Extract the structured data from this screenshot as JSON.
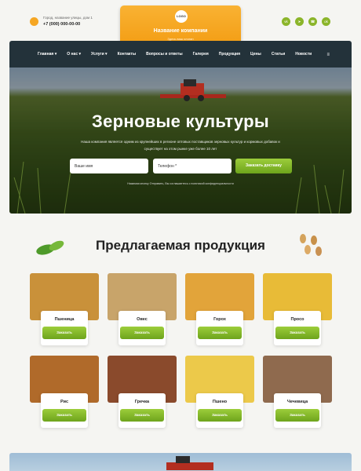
{
  "header": {
    "address": "Город, название улицы, дом 1",
    "phone": "+7 (000) 000-00-00",
    "logo_badge": "LOGO",
    "company_name": "Название компании",
    "tagline": "Здесь ваш слоган",
    "socials": [
      "vk",
      "tg",
      "wa",
      "ok"
    ]
  },
  "nav": {
    "items": [
      "Главная",
      "О нас",
      "Услуги",
      "Контакты",
      "Вопросы и ответы",
      "Галерея",
      "Продукция",
      "Цены",
      "Статьи",
      "Новости"
    ],
    "menu_icon": "≡"
  },
  "hero": {
    "title": "Зерновые культуры",
    "subtitle": "Наша компания является одним из крупнейших в регионе оптовых поставщиков зерновых культур и кормовых добавок и существует на этом рынке уже более 10 лет",
    "name_placeholder": "Ваше имя",
    "phone_placeholder": "Телефон *",
    "button": "Заказать доставку",
    "consent": "Нажимая кнопку Отправить, Вы соглашаетесь с политикой конфиденциальности"
  },
  "products": {
    "title": "Предлагаемая продукция",
    "order_label": "Заказать",
    "items": [
      {
        "name": "Пшеница",
        "color": "#c9913a"
      },
      {
        "name": "Овес",
        "color": "#c8a46a"
      },
      {
        "name": "Горох",
        "color": "#e2a43a"
      },
      {
        "name": "Просо",
        "color": "#e8bb37"
      },
      {
        "name": "Рис",
        "color": "#b06a2a"
      },
      {
        "name": "Гречка",
        "color": "#8a4a2c"
      },
      {
        "name": "Пшено",
        "color": "#ecc94a"
      },
      {
        "name": "Чечевица",
        "color": "#8f6a4e"
      }
    ]
  }
}
